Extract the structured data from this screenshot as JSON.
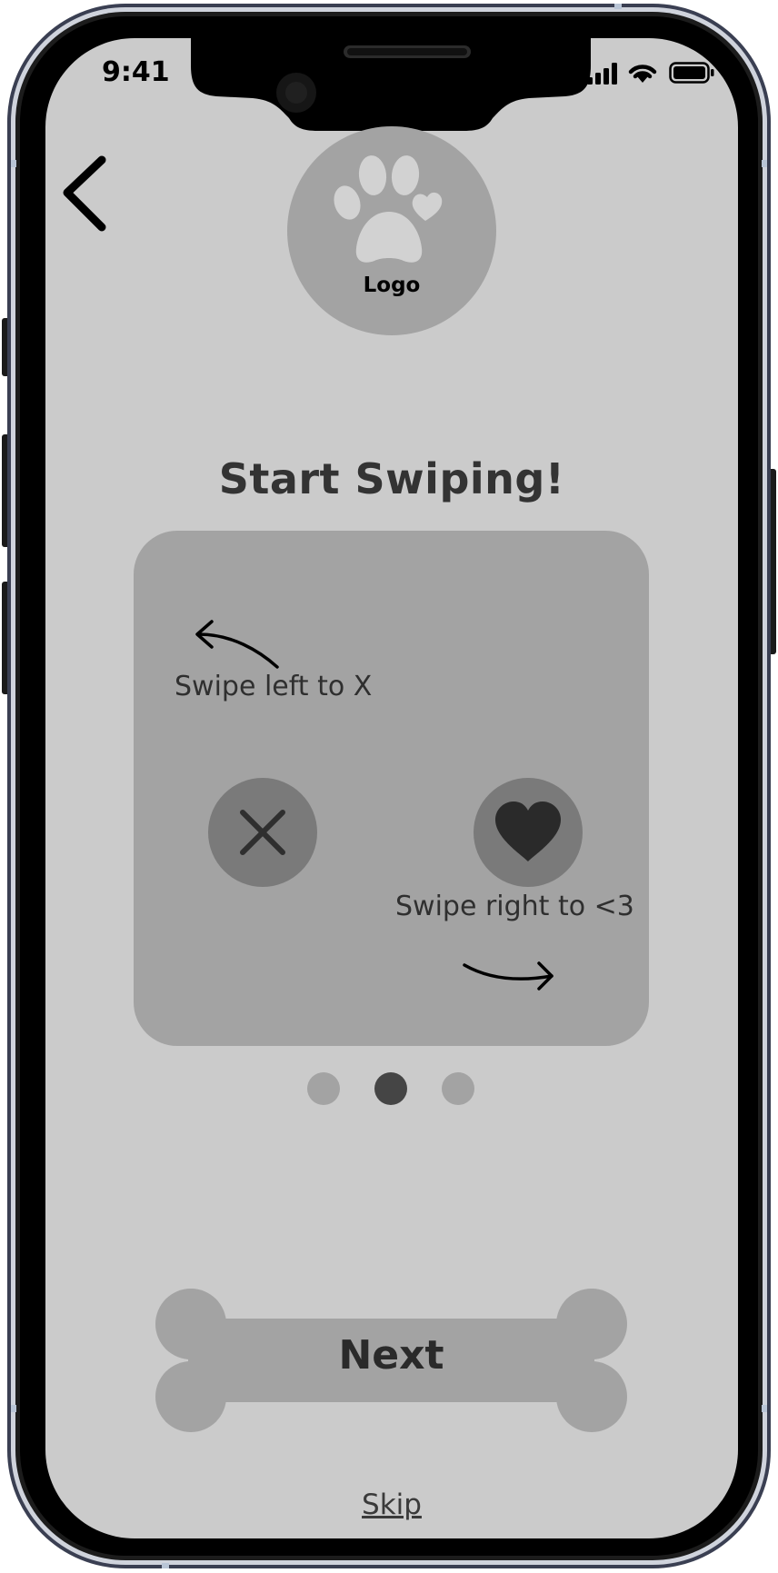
{
  "status_bar": {
    "time": "9:41"
  },
  "header": {
    "logo_label": "Logo"
  },
  "onboarding": {
    "title": "Start Swiping!",
    "swipe_left_hint": "Swipe left to X",
    "swipe_right_hint": "Swipe right to <3",
    "pagination": {
      "current_page": 2,
      "total_pages": 3
    }
  },
  "actions": {
    "next_label": "Next",
    "skip_label": "Skip"
  },
  "colors": {
    "screen_bg": "#cbcbcb",
    "card_bg": "#a3a3a3",
    "button_dark": "#7a7a7a",
    "dot_active": "#454545",
    "dot_inactive": "#a3a3a3"
  },
  "icons": [
    "back-chevron-icon",
    "paw-heart-icon",
    "close-icon",
    "heart-icon",
    "arrow-left-icon",
    "arrow-right-icon",
    "signal-icon",
    "wifi-icon",
    "battery-icon"
  ]
}
